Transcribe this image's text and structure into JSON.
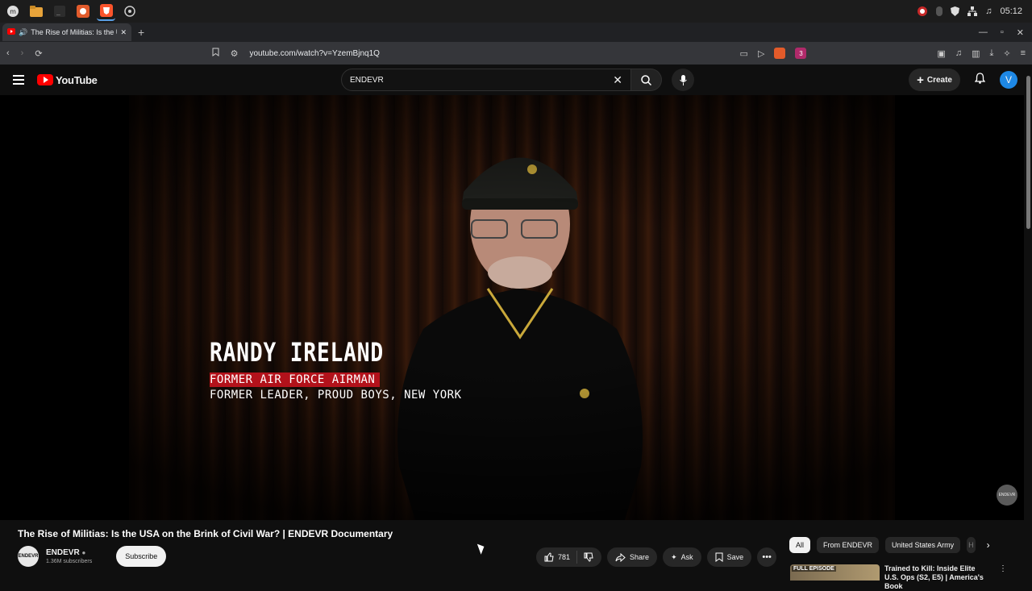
{
  "os_panel": {
    "launchers": [
      {
        "name": "mint-menu-icon",
        "color": "#4a4a4a"
      },
      {
        "name": "files-icon",
        "color": "#e7a33a"
      },
      {
        "name": "terminal-icon",
        "color": "#2d2d2d"
      },
      {
        "name": "firefox-icon",
        "color": "#e25b2c"
      },
      {
        "name": "brave-icon",
        "color": "#fb542b"
      },
      {
        "name": "webapp-icon",
        "color": "#3a3a3a"
      }
    ],
    "clock": "05:12"
  },
  "browser": {
    "tab_title": "The Rise of Militias: Is the U",
    "url": "youtube.com/watch?v=YzemBjnq1Q",
    "extension_badge": "3"
  },
  "youtube": {
    "logo_text": "YouTube",
    "search_query": "ENDEVR",
    "create_label": "Create",
    "avatar_letter": "V",
    "brand_red": "#ff0000"
  },
  "video": {
    "lower_third_name": "RANDY IRELAND",
    "lower_third_role1": "FORMER AIR FORCE AIRMAN",
    "lower_third_role2": "FORMER LEADER, PROUD BOYS, NEW YORK",
    "watermark": "ENDEVR",
    "title": "The Rise of Militias: Is the USA on the Brink of Civil War? | ENDEVR Documentary"
  },
  "channel": {
    "name": "ENDEVR",
    "subscribers": "1.36M subscribers",
    "subscribe_label": "Subscribe",
    "avatar_text": "ENDEVR"
  },
  "actions": {
    "likes": "781",
    "share_label": "Share",
    "ask_label": "Ask",
    "save_label": "Save"
  },
  "chips": [
    "All",
    "From ENDEVR",
    "United States Army",
    "H"
  ],
  "recommendation": {
    "badge": "FULL EPISODE",
    "title": "Trained to Kill: Inside Elite U.S. Ops (S2, E5) | America's Book"
  }
}
